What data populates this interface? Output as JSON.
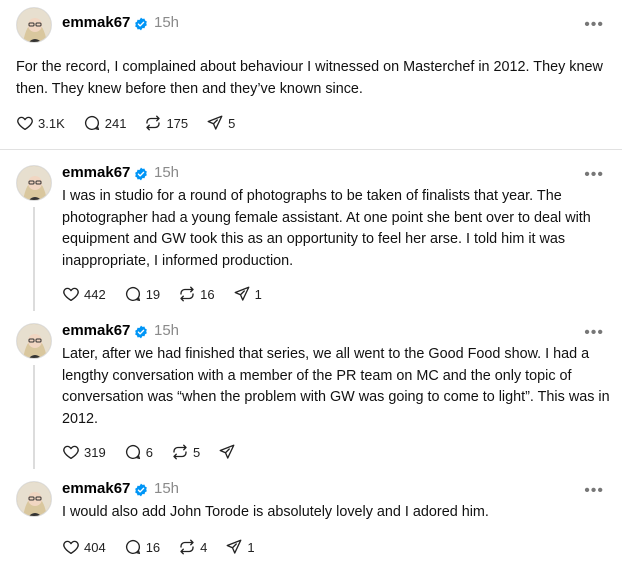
{
  "posts": [
    {
      "username": "emmak67",
      "time": "15h",
      "text": "For the record, I complained about behaviour I witnessed on Masterchef in 2012. They knew then. They knew before then and they’ve known since.",
      "likes": "3.1K",
      "replies": "241",
      "reposts": "175",
      "shares": "5"
    },
    {
      "username": "emmak67",
      "time": "15h",
      "text": "I was in studio for a round of photographs to be taken of finalists that year. The photographer had a young female assistant. At one point she bent over to deal with equipment and GW took this as an opportunity to feel her arse. I told him it was inappropriate, I informed production.",
      "likes": "442",
      "replies": "19",
      "reposts": "16",
      "shares": "1"
    },
    {
      "username": "emmak67",
      "time": "15h",
      "text": "Later, after we had finished that series, we all went to the Good Food show. I had a lengthy conversation with a member of the PR team on MC and the only topic of conversation was “when the problem with GW was going to come to light”. This was in 2012.",
      "likes": "319",
      "replies": "6",
      "reposts": "5",
      "shares": ""
    },
    {
      "username": "emmak67",
      "time": "15h",
      "text": "I would also add John Torode is absolutely lovely and I adored him.",
      "likes": "404",
      "replies": "16",
      "reposts": "4",
      "shares": "1"
    }
  ],
  "colors": {
    "verified": "#0095f6",
    "muted": "#8a8a8a",
    "thread_line": "#dcdcdc"
  }
}
